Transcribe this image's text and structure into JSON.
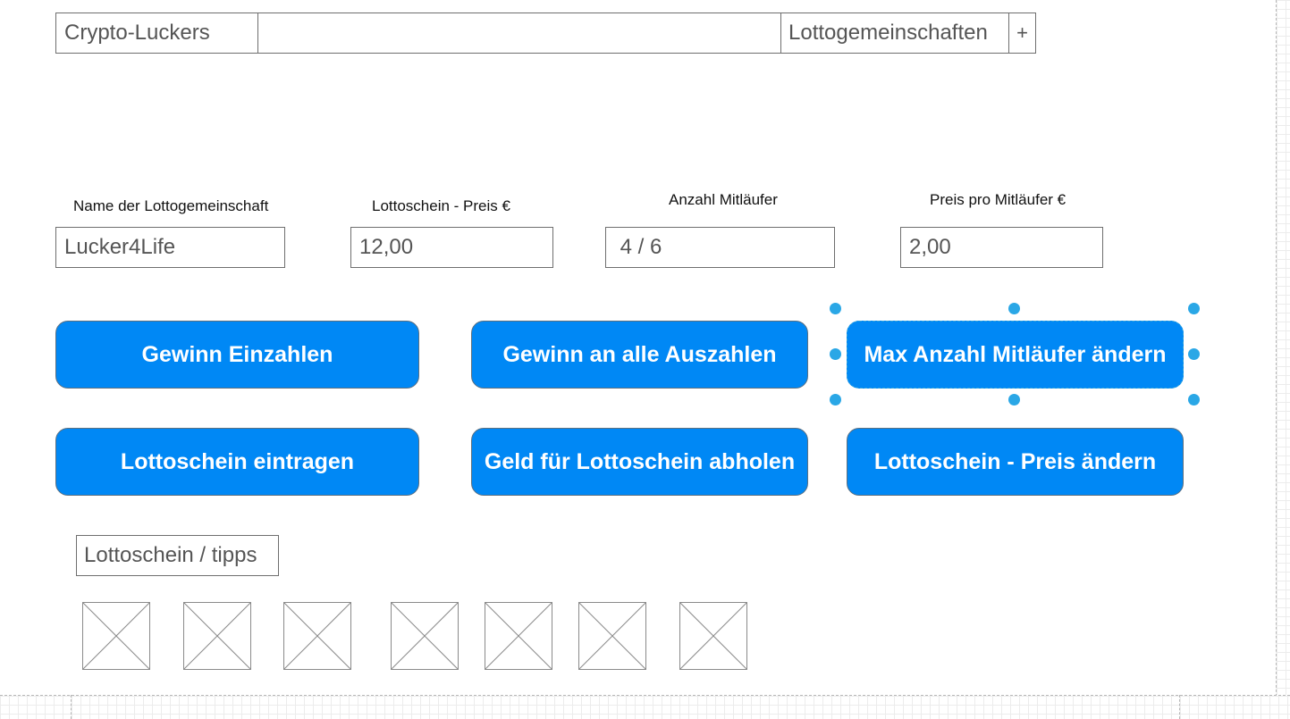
{
  "nav": {
    "brand": "Crypto-Luckers",
    "link": "Lottogemeinschaften",
    "add": "+"
  },
  "form": {
    "fields": [
      {
        "label": "Name der Lottogemeinschaft",
        "value": "Lucker4Life"
      },
      {
        "label": "Lottoschein - Preis €",
        "value": "12,00"
      },
      {
        "label": "Anzahl Mitläufer",
        "value": " 4 / 6"
      },
      {
        "label": "Preis pro Mitläufer €",
        "value": "2,00"
      }
    ]
  },
  "actions": {
    "gewinn_einzahlen": "Gewinn Einzahlen",
    "gewinn_auszahlen": "Gewinn an alle Auszahlen",
    "max_mitlaeufer": "Max Anzahl Mitläufer ändern",
    "schein_eintragen": "Lottoschein eintragen",
    "geld_abholen": "Geld für Lottoschein abholen",
    "preis_aendern": "Lottoschein - Preis ändern"
  },
  "tipps": {
    "label": "Lottoschein / tipps",
    "placeholder_icon": "image-placeholder-icon",
    "count": 7
  },
  "colors": {
    "button": "#0088f5",
    "selection": "#2aa7e6",
    "border": "#6e6e6e"
  }
}
